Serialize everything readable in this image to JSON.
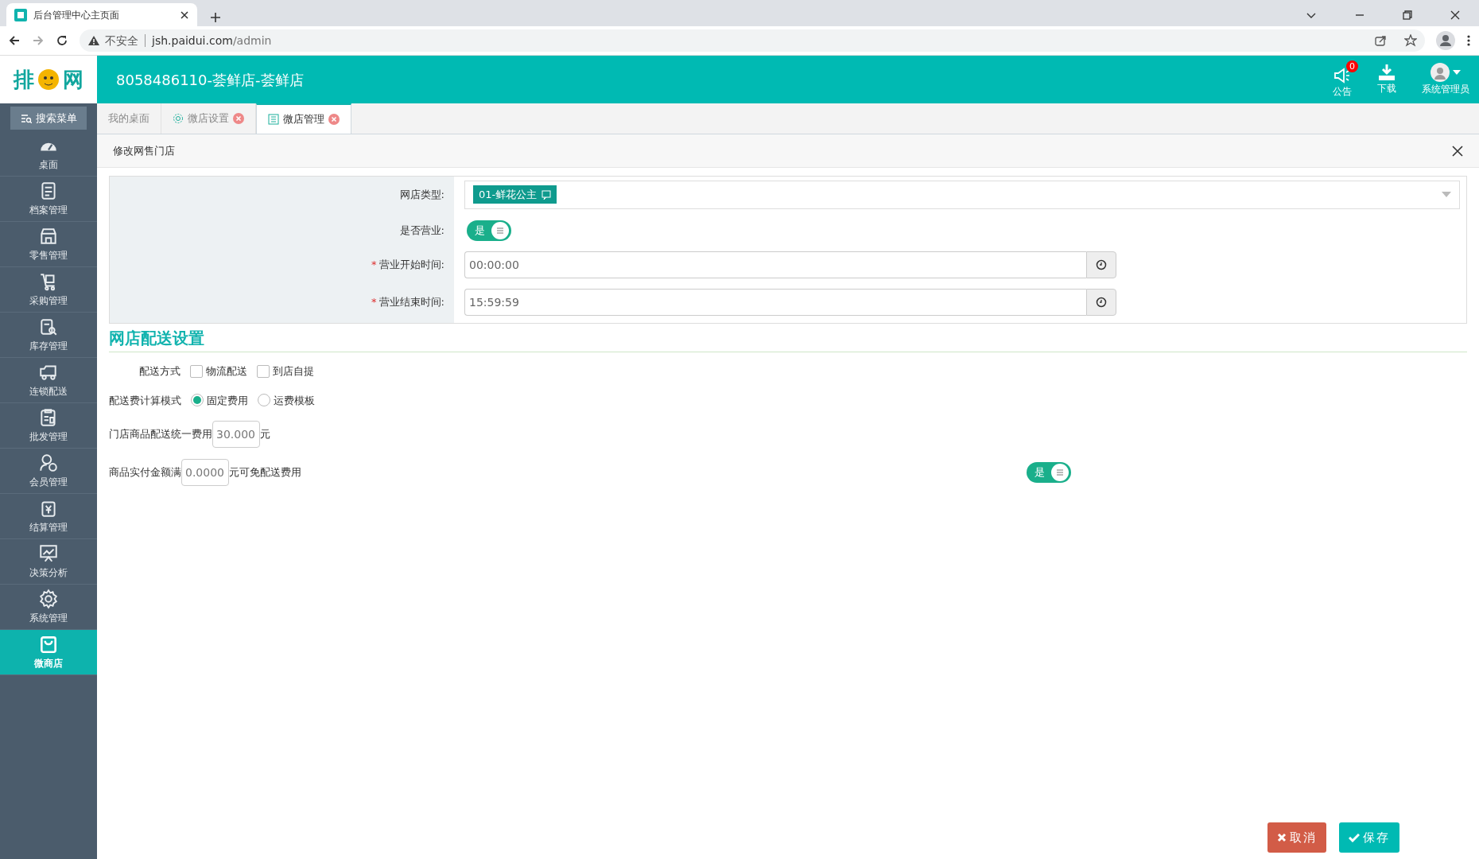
{
  "browser": {
    "tab_title": "后台管理中心主页面",
    "security": "不安全",
    "url_host": "jsh.paidui.com",
    "url_path": "/admin"
  },
  "header": {
    "logo": {
      "left": "排",
      "right": "网"
    },
    "title": "8058486110-荟鲜店-荟鲜店",
    "notice": {
      "label": "公告",
      "badge": "0"
    },
    "download": {
      "label": "下载"
    },
    "user": {
      "label": "系统管理员"
    }
  },
  "sidebar": {
    "search_button": "搜索菜单",
    "items": [
      {
        "label": "桌面",
        "selected": false
      },
      {
        "label": "档案管理",
        "selected": false
      },
      {
        "label": "零售管理",
        "selected": false
      },
      {
        "label": "采购管理",
        "selected": false
      },
      {
        "label": "库存管理",
        "selected": false
      },
      {
        "label": "连锁配送",
        "selected": false
      },
      {
        "label": "批发管理",
        "selected": false
      },
      {
        "label": "会员管理",
        "selected": false
      },
      {
        "label": "结算管理",
        "selected": false
      },
      {
        "label": "决策分析",
        "selected": false
      },
      {
        "label": "系统管理",
        "selected": false
      },
      {
        "label": "微商店",
        "selected": true
      }
    ]
  },
  "tabs": [
    {
      "label": "我的桌面",
      "selected": false,
      "closable": false
    },
    {
      "label": "微店设置",
      "selected": false,
      "closable": true
    },
    {
      "label": "微店管理",
      "selected": true,
      "closable": true
    }
  ],
  "panel": {
    "title": "修改网售门店"
  },
  "form": {
    "store_type": {
      "label": "网店类型:",
      "value": "01-鲜花公主"
    },
    "open": {
      "label": "是否营业:",
      "on": true,
      "text": "是"
    },
    "times": [
      {
        "label": "营业开始时间:",
        "required_mark": "*",
        "value": "00:00:00"
      },
      {
        "label": "营业结束时间:",
        "required_mark": "*",
        "value": "15:59:59"
      }
    ]
  },
  "delivery": {
    "title": "网店配送设置",
    "methods": {
      "label": "配送方式",
      "options": [
        {
          "label": "物流配送",
          "checked": false
        },
        {
          "label": "到店自提",
          "checked": false
        }
      ]
    },
    "fee_mode": {
      "label": "配送费计算模式",
      "options": [
        {
          "label": "固定费用",
          "selected": true
        },
        {
          "label": "运费模板",
          "selected": false
        }
      ]
    },
    "unified_fee": {
      "label": "门店商品配送统一费用",
      "value": "30.000",
      "unit": "元"
    },
    "free_threshold": {
      "label": "商品实付金额满",
      "value": "0.0000",
      "suffix": "元可免配送费用",
      "switch": {
        "on": true,
        "text": "是"
      }
    }
  },
  "buttons": {
    "cancel": "取消",
    "save": "保存"
  }
}
